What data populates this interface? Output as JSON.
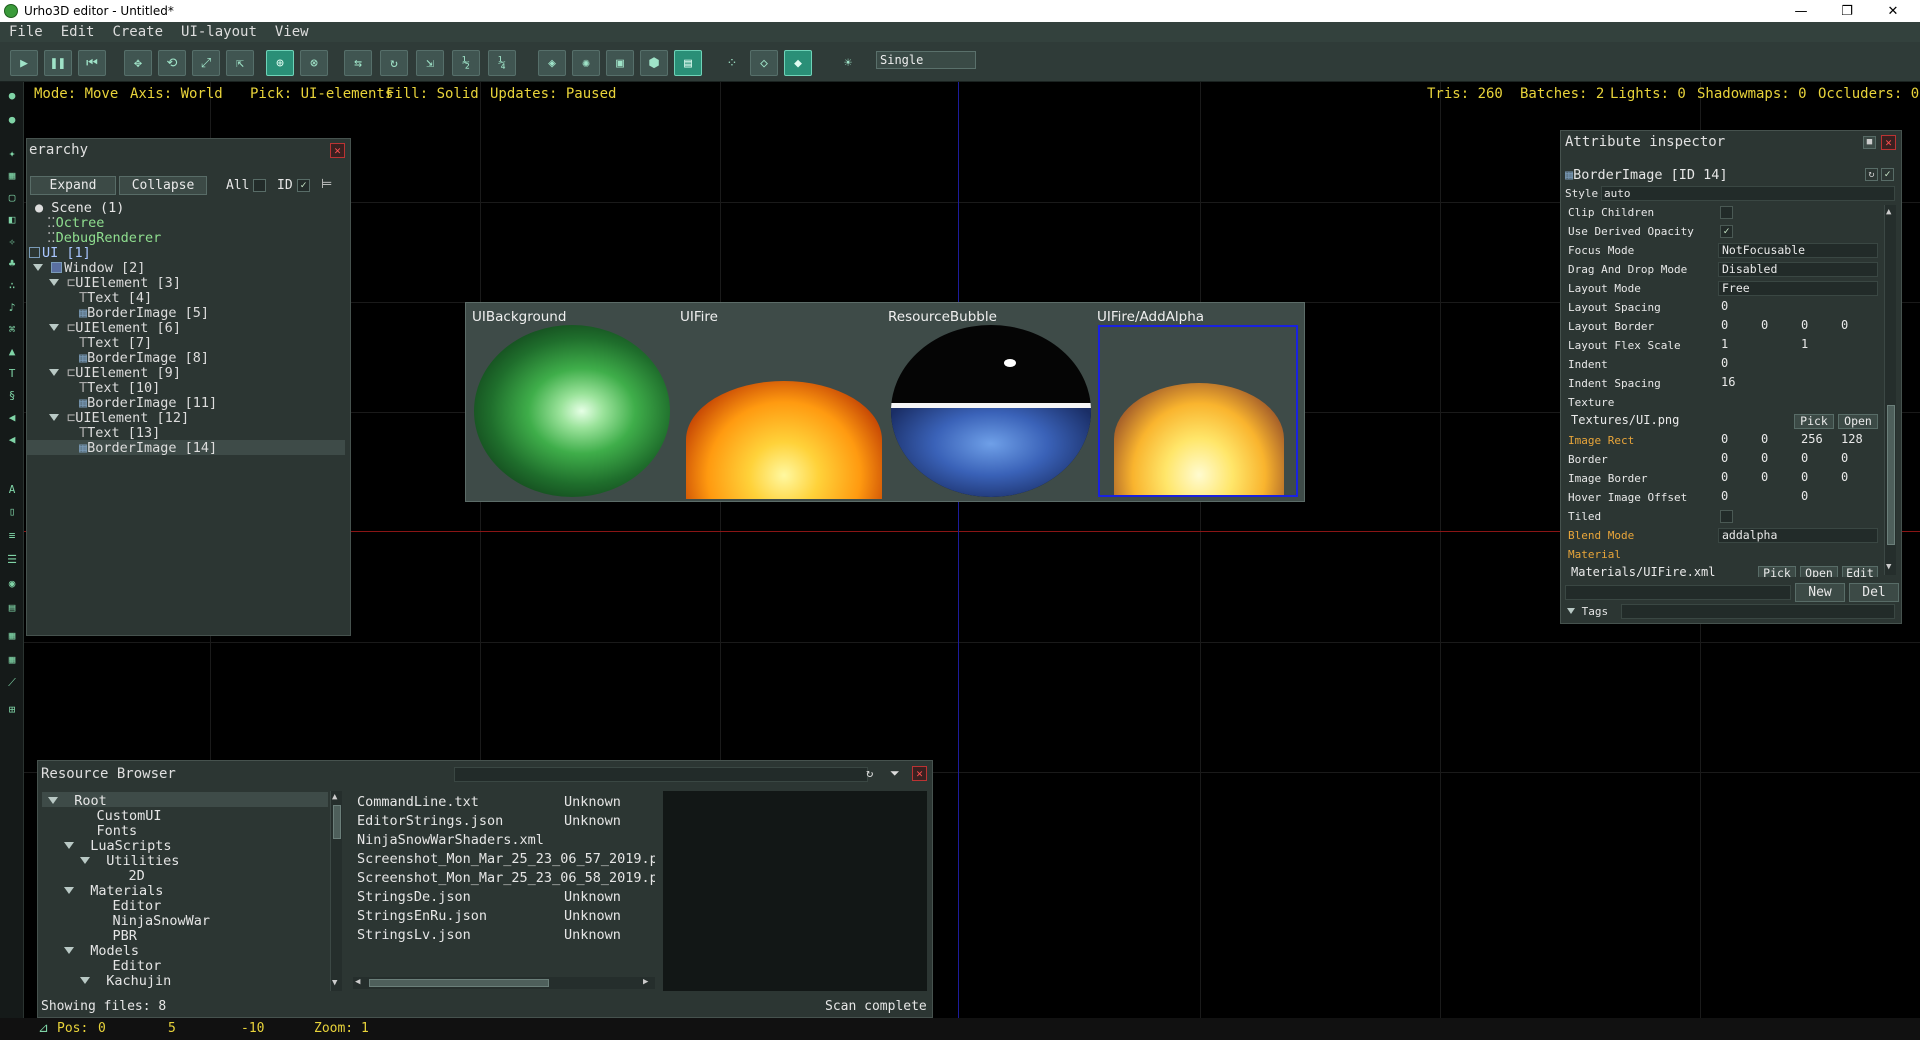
{
  "window": {
    "title": "Urho3D editor - Untitled*",
    "minimize": "—",
    "restore": "❐",
    "close": "✕"
  },
  "menu": [
    "File",
    "Edit",
    "Create",
    "UI-layout",
    "View"
  ],
  "toolbar": {
    "picking_mode": "Single",
    "icons": [
      "play-icon",
      "pause-icon",
      "revert-icon",
      "move-icon",
      "rotate-icon",
      "scale-icon",
      "select-icon",
      "world-axis-icon",
      "local-axis-icon",
      "snap-move-icon",
      "snap-rotate-icon",
      "snap-scale-icon",
      "snap-half-icon",
      "snap-quarter-icon",
      "pick-geometry-icon",
      "pick-lights-icon",
      "pick-zones-icon",
      "pick-rigidbody-icon",
      "pick-ui-icon",
      "fill-points-icon",
      "fill-wireframe-icon",
      "fill-solid-icon",
      "sun-icon"
    ]
  },
  "status": {
    "mode": "Mode: Move",
    "axis": "Axis: World",
    "pick": "Pick: UI-elements",
    "fill": "Fill: Solid",
    "updates": "Updates: Paused",
    "tris": "Tris: 260",
    "batches": "Batches: 2",
    "lights": "Lights: 0",
    "shadowmaps": "Shadowmaps: 0",
    "occluders": "Occluders: 0"
  },
  "hierarchy": {
    "title": "erarchy",
    "expand": "Expand",
    "collapse": "Collapse",
    "all": "All",
    "id": "ID",
    "items": [
      {
        "text": "Scene (1)",
        "depth": 0
      },
      {
        "text": "Octree",
        "depth": 1
      },
      {
        "text": "DebugRenderer",
        "depth": 1
      },
      {
        "text": "UI [1]",
        "depth": 0
      },
      {
        "text": "Window [2]",
        "depth": 1
      },
      {
        "text": "UIElement [3]",
        "depth": 2
      },
      {
        "text": "Text [4]",
        "depth": 3
      },
      {
        "text": "BorderImage [5]",
        "depth": 3
      },
      {
        "text": "UIElement [6]",
        "depth": 2
      },
      {
        "text": "Text [7]",
        "depth": 3
      },
      {
        "text": "BorderImage [8]",
        "depth": 3
      },
      {
        "text": "UIElement [9]",
        "depth": 2
      },
      {
        "text": "Text [10]",
        "depth": 3
      },
      {
        "text": "BorderImage [11]",
        "depth": 3
      },
      {
        "text": "UIElement [12]",
        "depth": 2
      },
      {
        "text": "Text [13]",
        "depth": 3
      },
      {
        "text": "BorderImage [14]",
        "depth": 3
      }
    ]
  },
  "demo": {
    "labels": [
      "UIBackground",
      "UIFire",
      "ResourceBubble",
      "UIFire/AddAlpha"
    ]
  },
  "inspector": {
    "title": "Attribute inspector",
    "element": "BorderImage  [ID 14]",
    "style_label": "Style",
    "style_value": "auto",
    "rows": [
      {
        "label": "Clip Children",
        "kind": "check",
        "value": ""
      },
      {
        "label": "Use Derived Opacity",
        "kind": "check",
        "value": "✓"
      },
      {
        "label": "Focus Mode",
        "kind": "drop",
        "value": "NotFocusable"
      },
      {
        "label": "Drag And Drop Mode",
        "kind": "drop",
        "value": "Disabled"
      },
      {
        "label": "Layout Mode",
        "kind": "drop",
        "value": "Free"
      },
      {
        "label": "Layout Spacing",
        "kind": "num",
        "value": "0"
      },
      {
        "label": "Layout Border",
        "kind": "num4",
        "value": "0",
        "v2": "0",
        "v3": "0",
        "v4": "0"
      },
      {
        "label": "Layout Flex Scale",
        "kind": "num2",
        "value": "1",
        "v2": "1"
      },
      {
        "label": "Indent",
        "kind": "num",
        "value": "0"
      },
      {
        "label": "Indent Spacing",
        "kind": "num",
        "value": "16"
      },
      {
        "label": "Texture",
        "kind": "none",
        "value": ""
      },
      {
        "label": "",
        "kind": "res",
        "value": "Textures/UI.png",
        "b1": "Pick",
        "b2": "Open"
      },
      {
        "label": "Image Rect",
        "kind": "num4",
        "mod": true,
        "value": "0",
        "v2": "0",
        "v3": "256",
        "v4": "128"
      },
      {
        "label": "Border",
        "kind": "num4",
        "value": "0",
        "v2": "0",
        "v3": "0",
        "v4": "0"
      },
      {
        "label": "Image Border",
        "kind": "num4",
        "value": "0",
        "v2": "0",
        "v3": "0",
        "v4": "0"
      },
      {
        "label": "Hover Image Offset",
        "kind": "num2",
        "value": "0",
        "v2": "0"
      },
      {
        "label": "Tiled",
        "kind": "check",
        "value": ""
      },
      {
        "label": "Blend Mode",
        "kind": "drop",
        "mod": true,
        "value": "addalpha"
      },
      {
        "label": "Material",
        "kind": "none",
        "mod": true,
        "value": ""
      },
      {
        "label": "",
        "kind": "res3",
        "value": "Materials/UIFire.xml",
        "b1": "Pick",
        "b2": "Open",
        "b3": "Edit"
      }
    ],
    "new_btn": "New",
    "del_btn": "Del",
    "tags": "Tags"
  },
  "resources": {
    "title": "Resource Browser",
    "folders": [
      {
        "text": "Root",
        "depth": 0,
        "open": true
      },
      {
        "text": "CustomUI",
        "depth": 1
      },
      {
        "text": "Fonts",
        "depth": 1
      },
      {
        "text": "LuaScripts",
        "depth": 1,
        "open": true
      },
      {
        "text": "Utilities",
        "depth": 2,
        "open": true
      },
      {
        "text": "2D",
        "depth": 3
      },
      {
        "text": "Materials",
        "depth": 1,
        "open": true
      },
      {
        "text": "Editor",
        "depth": 2
      },
      {
        "text": "NinjaSnowWar",
        "depth": 2
      },
      {
        "text": "PBR",
        "depth": 2
      },
      {
        "text": "Models",
        "depth": 1,
        "open": true
      },
      {
        "text": "Editor",
        "depth": 2
      },
      {
        "text": "Kachujin",
        "depth": 2,
        "open": true
      }
    ],
    "files": [
      {
        "name": "CommandLine.txt",
        "type": "Unknown"
      },
      {
        "name": "EditorStrings.json",
        "type": "Unknown"
      },
      {
        "name": "NinjaSnowWarShaders.xml",
        "type": ""
      },
      {
        "name": "Screenshot_Mon_Mar_25_23_06_57_2019.p",
        "type": ""
      },
      {
        "name": "Screenshot_Mon_Mar_25_23_06_58_2019.p",
        "type": ""
      },
      {
        "name": "StringsDe.json",
        "type": "Unknown"
      },
      {
        "name": "StringsEnRu.json",
        "type": "Unknown"
      },
      {
        "name": "StringsLv.json",
        "type": "Unknown"
      }
    ],
    "showing": "Showing files: 8",
    "scan": "Scan complete"
  },
  "bottom": {
    "pos_label": "Pos:",
    "x": "0",
    "y": "5",
    "z": "-10",
    "zoom": "Zoom: 1"
  }
}
